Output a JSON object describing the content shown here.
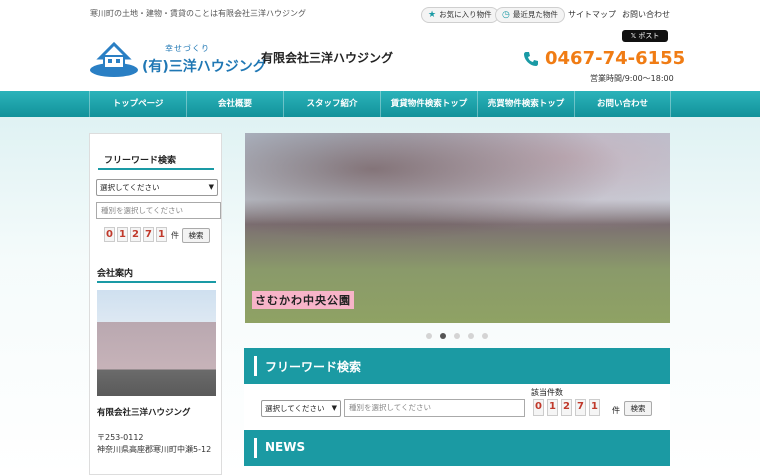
{
  "header": {
    "tagline": "寒川町の土地・建物・賃貸のことは有限会社三洋ハウジング",
    "favorites": "お気に入り物件",
    "recent": "最近見た物件",
    "sitemap": "サイトマップ",
    "contact": "お問い合わせ",
    "x_post": "𝕏 ポスト",
    "logo_sub": "幸せづくり",
    "logo_name": "(有)三洋ハウジング",
    "company": "有限会社三洋ハウジング",
    "phone": "0467-74-6155",
    "hours": "営業時間/9:00～18:00"
  },
  "nav": [
    {
      "label": "トップページ"
    },
    {
      "label": "会社概要"
    },
    {
      "label": "スタッフ紹介"
    },
    {
      "label": "賃貸物件検索トップ"
    },
    {
      "label": "売買物件検索トップ"
    },
    {
      "label": "お問い合わせ"
    }
  ],
  "sidebar": {
    "search_title": "フリーワード検索",
    "select_value": "選択してください",
    "input_placeholder": "種別を選択してください",
    "digits": [
      "0",
      "1",
      "2",
      "7",
      "1"
    ],
    "unit": "件",
    "search_btn": "検索",
    "company_title": "会社案内",
    "company_name": "有限会社三洋ハウジング",
    "zip": "〒253-0112",
    "address": "神奈川県高座郡寒川町中瀬5-12"
  },
  "slider": {
    "caption": "さむかわ中央公園",
    "dots": 5,
    "active": 1
  },
  "main": {
    "search_title": "フリーワード検索",
    "count_label": "該当件数",
    "select_value": "選択してください",
    "input_placeholder": "種別を選択してください",
    "digits": [
      "0",
      "1",
      "2",
      "7",
      "1"
    ],
    "unit": "件",
    "search_btn": "検索",
    "news_title": "NEWS"
  },
  "colors": {
    "teal": "#1b9aa3",
    "orange": "#f07c14",
    "digit": "#c0392b"
  }
}
